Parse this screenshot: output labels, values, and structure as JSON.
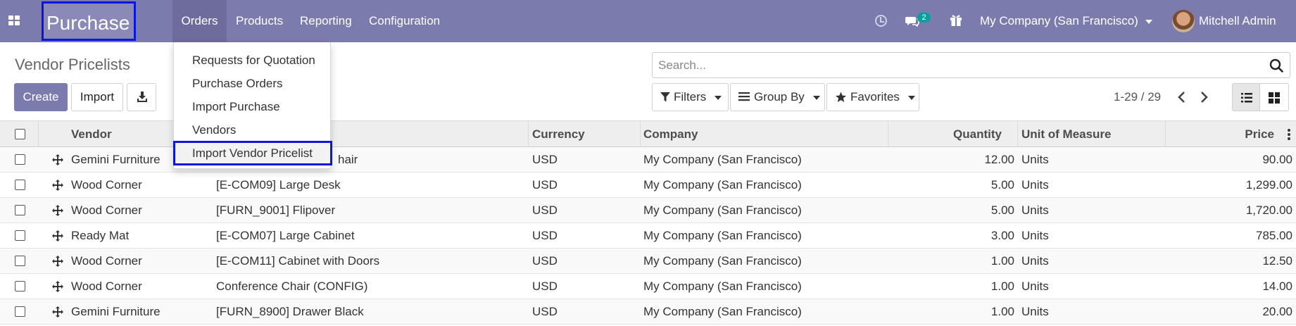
{
  "navbar": {
    "app_name": "Purchase",
    "menu": [
      "Orders",
      "Products",
      "Reporting",
      "Configuration"
    ],
    "chat_count": "2",
    "company": "My Company (San Francisco)",
    "user": "Mitchell Admin",
    "bg_color": "#7c7bad"
  },
  "orders_menu": {
    "items": [
      "Requests for Quotation",
      "Purchase Orders",
      "Import Purchase",
      "Vendors",
      "Import Vendor Pricelist"
    ],
    "highlighted": "Import Vendor Pricelist"
  },
  "control_panel": {
    "title": "Vendor Pricelists",
    "create_label": "Create",
    "import_label": "Import",
    "search_placeholder": "Search...",
    "filters_label": "Filters",
    "groupby_label": "Group By",
    "favorites_label": "Favorites",
    "pager": "1-29 / 29"
  },
  "table": {
    "columns": [
      "Vendor",
      "Currency",
      "Company",
      "Quantity",
      "Unit of Measure",
      "Price"
    ],
    "rows": [
      {
        "vendor": "Gemini Furniture",
        "product": "hair",
        "currency": "USD",
        "company": "My Company (San Francisco)",
        "quantity": "12.00",
        "uom": "Units",
        "price": "90.00"
      },
      {
        "vendor": "Wood Corner",
        "product": "[E-COM09] Large Desk",
        "currency": "USD",
        "company": "My Company (San Francisco)",
        "quantity": "5.00",
        "uom": "Units",
        "price": "1,299.00"
      },
      {
        "vendor": "Wood Corner",
        "product": "[FURN_9001] Flipover",
        "currency": "USD",
        "company": "My Company (San Francisco)",
        "quantity": "5.00",
        "uom": "Units",
        "price": "1,720.00"
      },
      {
        "vendor": "Ready Mat",
        "product": "[E-COM07] Large Cabinet",
        "currency": "USD",
        "company": "My Company (San Francisco)",
        "quantity": "3.00",
        "uom": "Units",
        "price": "785.00"
      },
      {
        "vendor": "Wood Corner",
        "product": "[E-COM11] Cabinet with Doors",
        "currency": "USD",
        "company": "My Company (San Francisco)",
        "quantity": "1.00",
        "uom": "Units",
        "price": "12.50"
      },
      {
        "vendor": "Wood Corner",
        "product": "Conference Chair (CONFIG)",
        "currency": "USD",
        "company": "My Company (San Francisco)",
        "quantity": "1.00",
        "uom": "Units",
        "price": "14.00"
      },
      {
        "vendor": "Gemini Furniture",
        "product": "[FURN_8900] Drawer Black",
        "currency": "USD",
        "company": "My Company (San Francisco)",
        "quantity": "1.00",
        "uom": "Units",
        "price": "20.00"
      }
    ]
  }
}
